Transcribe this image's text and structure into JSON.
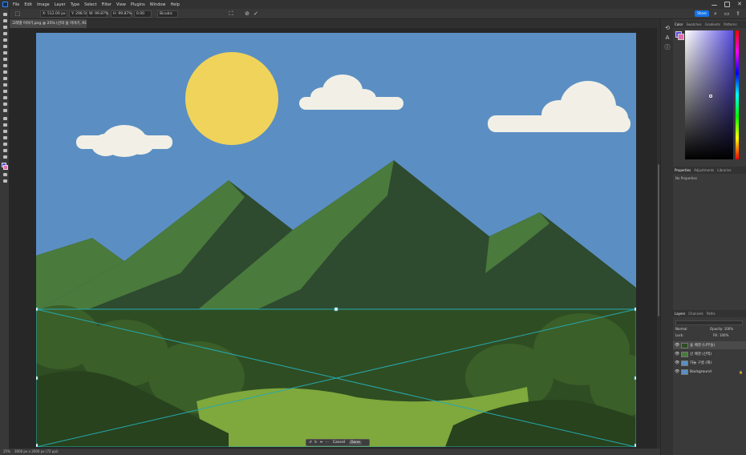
{
  "menubar": {
    "items": [
      "File",
      "Edit",
      "Image",
      "Layer",
      "Type",
      "Select",
      "Filter",
      "View",
      "Plugins",
      "Window",
      "Help"
    ]
  },
  "options_bar": {
    "x_field": "X: 512.00 px",
    "y_field": "Y: 298.50 px",
    "w_field": "W: 99.87%",
    "h_field": "H: 99.87%",
    "angle_field": "0.00",
    "interp_field": "Bicubic",
    "share_label": "Share"
  },
  "document": {
    "tab_title": "고래별 이야기.png @ 25% (산의 숲 이야기, RGB/8#) *"
  },
  "context_bar": {
    "cancel_label": "Cancel",
    "done_label": "Done"
  },
  "status_bar": {
    "zoom": "25%",
    "doc_info": "3000 px x 2000 px (72 ppi)"
  },
  "color_panel": {
    "tabs": [
      "Color",
      "Swatches",
      "Gradients",
      "Patterns"
    ],
    "hue_hex": "#5a4fe0"
  },
  "properties_panel": {
    "tabs": [
      "Properties",
      "Adjustments",
      "Libraries"
    ],
    "empty_text": "No Properties"
  },
  "layers_panel": {
    "tabs": [
      "Layers",
      "Channels",
      "Paths"
    ],
    "mode": "Normal",
    "opacity_label": "Opacity: 100%",
    "lock_label": "Lock:",
    "fill_label": "Fill: 100%",
    "layers": [
      {
        "name": "숲 배경 (나무들)",
        "visible": true,
        "selected": true
      },
      {
        "name": "산 배경 (산맥)",
        "visible": true,
        "selected": false
      },
      {
        "name": "하늘 구름 (해)",
        "visible": true,
        "selected": false
      },
      {
        "name": "Background",
        "visible": true,
        "selected": false
      }
    ]
  },
  "colors": {
    "sky": "#5b8fc4",
    "sun": "#f0d35a",
    "cloud": "#f2f0e6",
    "mountain_light": "#4a7a3c",
    "mountain_dark": "#2e4a2f",
    "forest": "#2f4d22",
    "meadow": "#7fa83d",
    "transform": "#27a9b0"
  }
}
